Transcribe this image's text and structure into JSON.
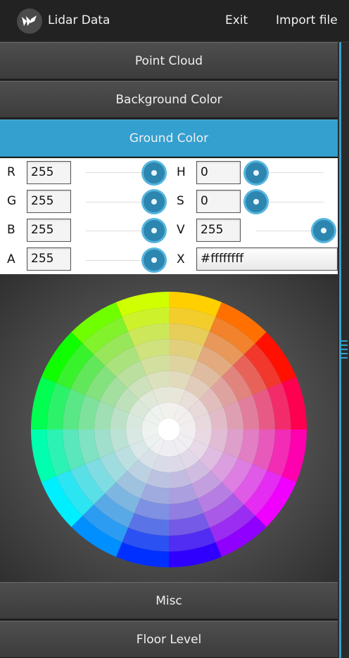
{
  "app": {
    "title": "Lidar Data",
    "exit_label": "Exit",
    "import_label": "Import file",
    "logo_icon": "kivy-logo-icon"
  },
  "sections": [
    {
      "label": "Point Cloud",
      "active": false
    },
    {
      "label": "Background Color",
      "active": false
    },
    {
      "label": "Ground Color",
      "active": true
    },
    {
      "label": "Misc",
      "active": false
    },
    {
      "label": "Floor Level",
      "active": false
    }
  ],
  "color_picker": {
    "rgba": [
      {
        "label": "R",
        "value": "255",
        "level": 1.0
      },
      {
        "label": "G",
        "value": "255",
        "level": 1.0
      },
      {
        "label": "B",
        "value": "255",
        "level": 1.0
      },
      {
        "label": "A",
        "value": "255",
        "level": 1.0
      }
    ],
    "hsv": [
      {
        "label": "H",
        "value": "0",
        "level": 0.0
      },
      {
        "label": "S",
        "value": "0",
        "level": 0.0
      },
      {
        "label": "V",
        "value": "255",
        "level": 1.0
      }
    ],
    "hex": {
      "label": "X",
      "value": "#ffffffff"
    },
    "wheel": {
      "segments": 16,
      "rings": 8,
      "selected_color": "#ffffffff"
    }
  },
  "colors": {
    "accent": "#33a0d0",
    "knob": "#2c86b0",
    "header_bg": "#4a4a4a",
    "actionbar_bg": "#222222"
  }
}
